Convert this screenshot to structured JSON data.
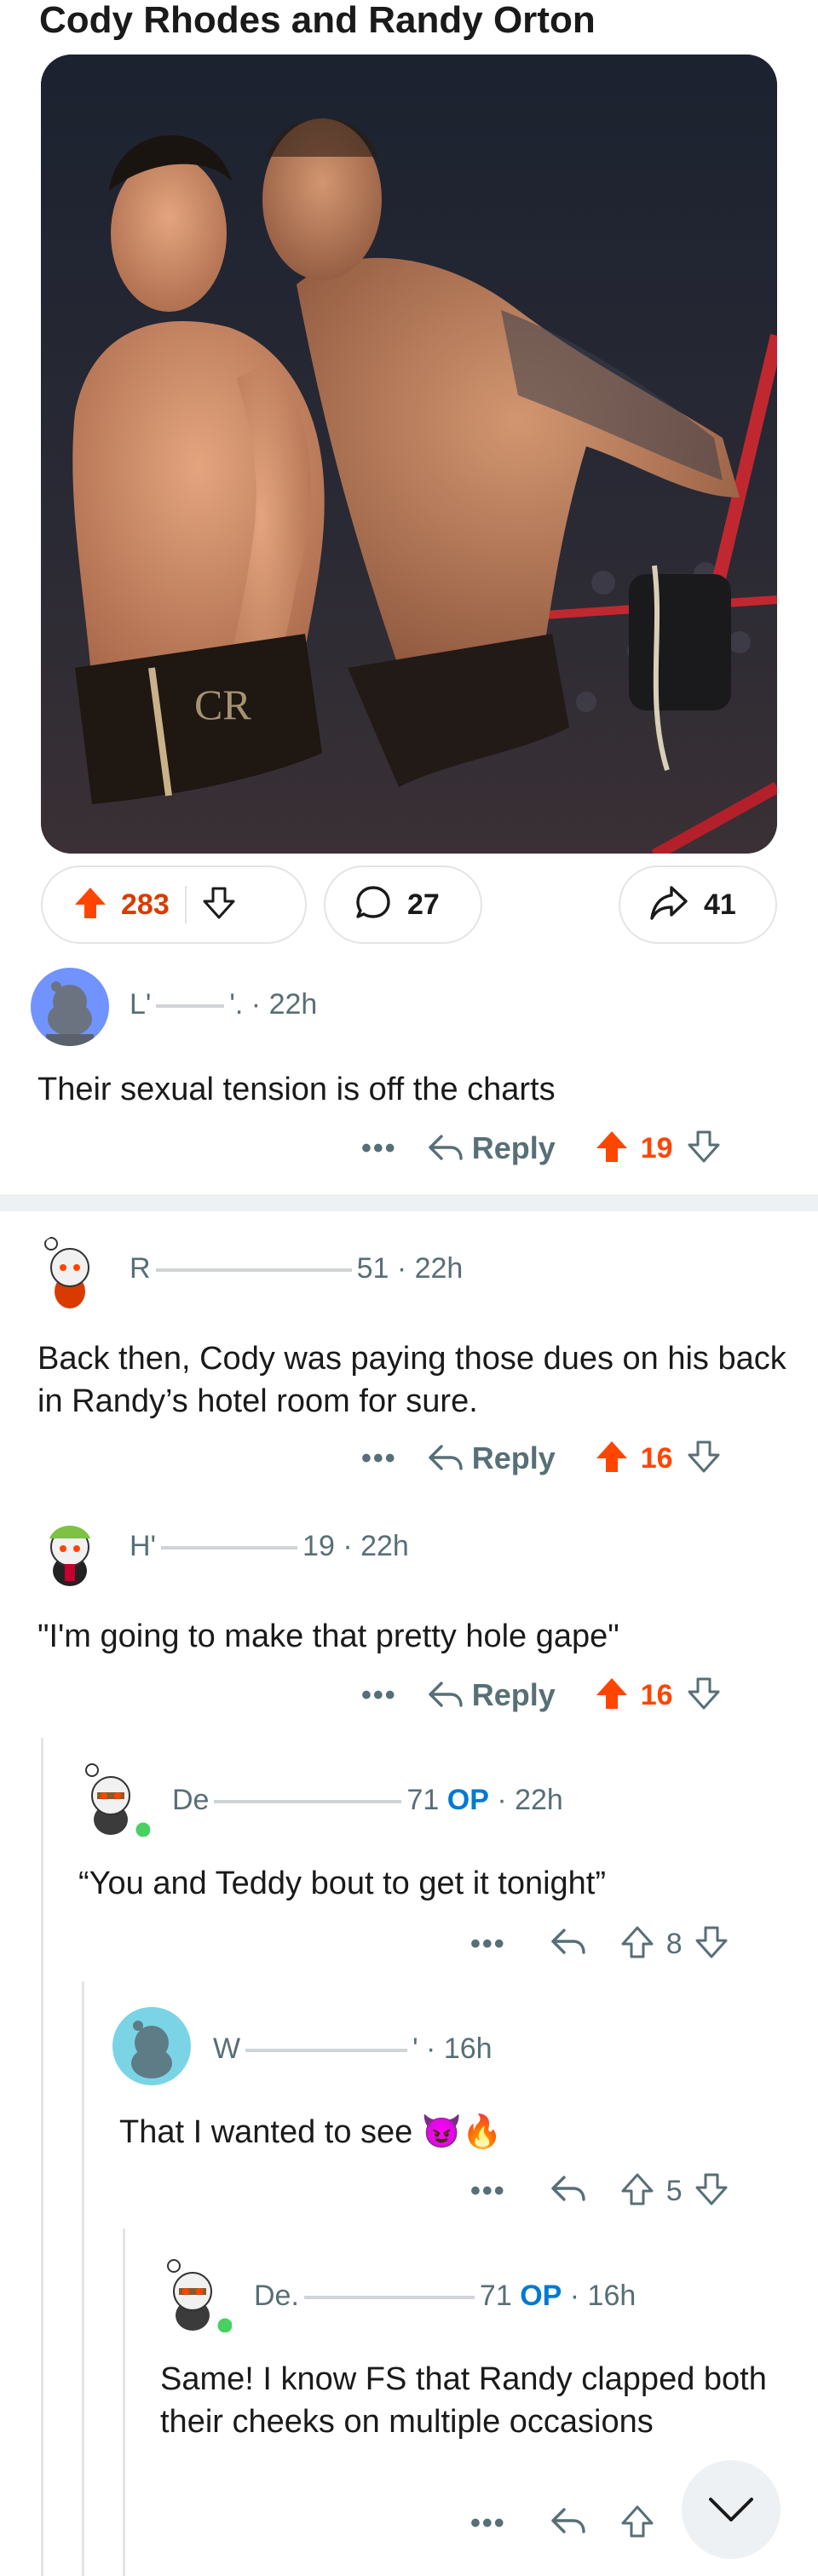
{
  "post": {
    "title": "Cody Rhodes and Randy Orton",
    "upvotes": "283",
    "comments": "27",
    "shares": "41"
  },
  "comments": [
    {
      "user_visible": "L'",
      "user_tail": "'.",
      "time": "· 22h",
      "text": "Their sexual tension is off the charts",
      "reply_label": "Reply",
      "score": "19"
    },
    {
      "user_visible": "R",
      "user_tail": "51",
      "time": "· 22h",
      "text": "Back then, Cody was paying those dues on his back in Randy’s hotel room for sure.",
      "reply_label": "Reply",
      "score": "16"
    },
    {
      "user_visible": "H'",
      "user_tail": "19",
      "time": "· 22h",
      "text": "\"I'm going to make that pretty hole gape\"",
      "reply_label": "Reply",
      "score": "16"
    },
    {
      "user_visible": "De",
      "user_tail": "71",
      "op": "OP",
      "time": "· 22h",
      "text": "“You and Teddy bout to get it tonight”",
      "score": "8"
    },
    {
      "user_visible": "W",
      "user_tail": "'",
      "time": "· 16h",
      "text": "That I wanted to see",
      "emoji": "😈🔥",
      "score": "5"
    },
    {
      "user_visible": "De.",
      "user_tail": "71",
      "op": "OP",
      "time": "· 16h",
      "text": "Same! I know FS that Randy clapped both their cheeks on multiple occasions",
      "score": ""
    }
  ],
  "colors": {
    "upvote": "#ff4500",
    "op": "#0079d3",
    "muted": "#576f76"
  },
  "icons": [
    "upvote-icon",
    "downvote-icon",
    "comment-icon",
    "share-icon",
    "more-icon",
    "reply-icon",
    "scroll-down-icon"
  ]
}
